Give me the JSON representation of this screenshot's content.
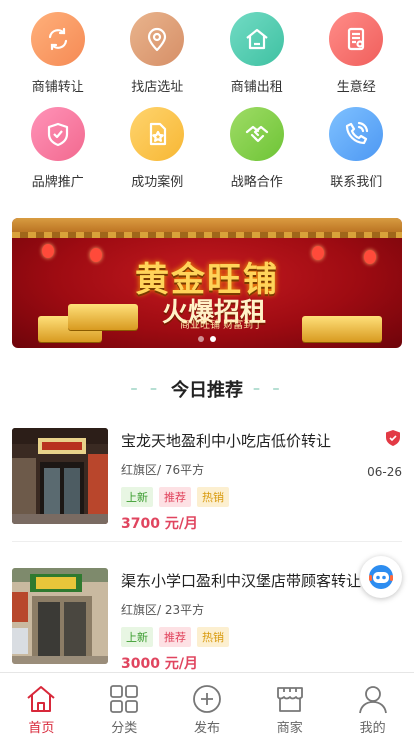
{
  "categories": [
    {
      "label": "商铺转让",
      "icon": "refresh-icon"
    },
    {
      "label": "找店选址",
      "icon": "location-pin-icon"
    },
    {
      "label": "商铺出租",
      "icon": "house-icon"
    },
    {
      "label": "生意经",
      "icon": "document-icon"
    },
    {
      "label": "品牌推广",
      "icon": "shield-check-icon"
    },
    {
      "label": "成功案例",
      "icon": "star-document-icon"
    },
    {
      "label": "战略合作",
      "icon": "handshake-icon"
    },
    {
      "label": "联系我们",
      "icon": "phone-icon"
    }
  ],
  "banner": {
    "headline": "黄金旺铺",
    "subheadline": "火爆招租",
    "tagline": "商业旺铺  财富到了",
    "slide_count": 2,
    "active_slide": 1
  },
  "section": {
    "title": "今日推荐",
    "decoration": "– –"
  },
  "listings": [
    {
      "title": "宝龙天地盈利中小吃店低价转让",
      "meta": "红旗区/ 76平方",
      "date": "06-26",
      "tags": [
        "上新",
        "推荐",
        "热销"
      ],
      "price": "3700 元/月"
    },
    {
      "title": "渠东小学口盈利中汉堡店带顾客转让",
      "meta": "红旗区/ 23平方",
      "date": "",
      "tags": [
        "上新",
        "推荐",
        "热销"
      ],
      "price": "3000 元/月"
    }
  ],
  "tabs": [
    {
      "label": "首页",
      "icon": "home-icon",
      "active": true
    },
    {
      "label": "分类",
      "icon": "grid-icon",
      "active": false
    },
    {
      "label": "发布",
      "icon": "plus-circle-icon",
      "active": false
    },
    {
      "label": "商家",
      "icon": "store-icon",
      "active": false
    },
    {
      "label": "我的",
      "icon": "user-icon",
      "active": false
    }
  ],
  "colors": {
    "accent": "#d8283a",
    "price": "#e0455f",
    "section_deco": "#6cbfa7"
  }
}
